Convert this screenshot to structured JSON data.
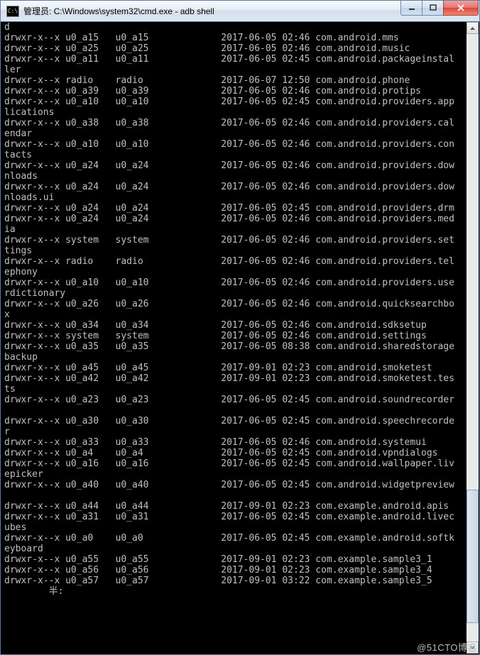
{
  "window": {
    "icon_text": "C:\\",
    "title": "管理员: C:\\Windows\\system32\\cmd.exe - adb  shell"
  },
  "prompt_lead": "d",
  "listing": [
    {
      "perm": "drwxr-x--x",
      "owner": "u0_a15",
      "group": "u0_a15",
      "date": "2017-06-05",
      "time": "02:46",
      "name": "com.android.mms",
      "wrap": ""
    },
    {
      "perm": "drwxr-x--x",
      "owner": "u0_a25",
      "group": "u0_a25",
      "date": "2017-06-05",
      "time": "02:46",
      "name": "com.android.music",
      "wrap": ""
    },
    {
      "perm": "drwxr-x--x",
      "owner": "u0_a11",
      "group": "u0_a11",
      "date": "2017-06-05",
      "time": "02:45",
      "name": "com.android.packageinstal",
      "wrap": "ler"
    },
    {
      "perm": "drwxr-x--x",
      "owner": "radio",
      "group": "radio",
      "date": "2017-06-07",
      "time": "12:50",
      "name": "com.android.phone",
      "wrap": ""
    },
    {
      "perm": "drwxr-x--x",
      "owner": "u0_a39",
      "group": "u0_a39",
      "date": "2017-06-05",
      "time": "02:46",
      "name": "com.android.protips",
      "wrap": ""
    },
    {
      "perm": "drwxr-x--x",
      "owner": "u0_a10",
      "group": "u0_a10",
      "date": "2017-06-05",
      "time": "02:45",
      "name": "com.android.providers.app",
      "wrap": "lications"
    },
    {
      "perm": "drwxr-x--x",
      "owner": "u0_a38",
      "group": "u0_a38",
      "date": "2017-06-05",
      "time": "02:46",
      "name": "com.android.providers.cal",
      "wrap": "endar"
    },
    {
      "perm": "drwxr-x--x",
      "owner": "u0_a10",
      "group": "u0_a10",
      "date": "2017-06-05",
      "time": "02:46",
      "name": "com.android.providers.con",
      "wrap": "tacts"
    },
    {
      "perm": "drwxr-x--x",
      "owner": "u0_a24",
      "group": "u0_a24",
      "date": "2017-06-05",
      "time": "02:46",
      "name": "com.android.providers.dow",
      "wrap": "nloads"
    },
    {
      "perm": "drwxr-x--x",
      "owner": "u0_a24",
      "group": "u0_a24",
      "date": "2017-06-05",
      "time": "02:46",
      "name": "com.android.providers.dow",
      "wrap": "nloads.ui"
    },
    {
      "perm": "drwxr-x--x",
      "owner": "u0_a24",
      "group": "u0_a24",
      "date": "2017-06-05",
      "time": "02:45",
      "name": "com.android.providers.drm",
      "wrap": ""
    },
    {
      "perm": "drwxr-x--x",
      "owner": "u0_a24",
      "group": "u0_a24",
      "date": "2017-06-05",
      "time": "02:46",
      "name": "com.android.providers.med",
      "wrap": "ia"
    },
    {
      "perm": "drwxr-x--x",
      "owner": "system",
      "group": "system",
      "date": "2017-06-05",
      "time": "02:46",
      "name": "com.android.providers.set",
      "wrap": "tings"
    },
    {
      "perm": "drwxr-x--x",
      "owner": "radio",
      "group": "radio",
      "date": "2017-06-05",
      "time": "02:46",
      "name": "com.android.providers.tel",
      "wrap": "ephony"
    },
    {
      "perm": "drwxr-x--x",
      "owner": "u0_a10",
      "group": "u0_a10",
      "date": "2017-06-05",
      "time": "02:46",
      "name": "com.android.providers.use",
      "wrap": "rdictionary"
    },
    {
      "perm": "drwxr-x--x",
      "owner": "u0_a26",
      "group": "u0_a26",
      "date": "2017-06-05",
      "time": "02:46",
      "name": "com.android.quicksearchbo",
      "wrap": "x"
    },
    {
      "perm": "drwxr-x--x",
      "owner": "u0_a34",
      "group": "u0_a34",
      "date": "2017-06-05",
      "time": "02:46",
      "name": "com.android.sdksetup",
      "wrap": ""
    },
    {
      "perm": "drwxr-x--x",
      "owner": "system",
      "group": "system",
      "date": "2017-06-05",
      "time": "02:46",
      "name": "com.android.settings",
      "wrap": ""
    },
    {
      "perm": "drwxr-x--x",
      "owner": "u0_a35",
      "group": "u0_a35",
      "date": "2017-06-05",
      "time": "08:38",
      "name": "com.android.sharedstorage",
      "wrap": "backup"
    },
    {
      "perm": "drwxr-x--x",
      "owner": "u0_a45",
      "group": "u0_a45",
      "date": "2017-09-01",
      "time": "02:23",
      "name": "com.android.smoketest",
      "wrap": ""
    },
    {
      "perm": "drwxr-x--x",
      "owner": "u0_a42",
      "group": "u0_a42",
      "date": "2017-09-01",
      "time": "02:23",
      "name": "com.android.smoketest.tes",
      "wrap": "ts"
    },
    {
      "perm": "drwxr-x--x",
      "owner": "u0_a23",
      "group": "u0_a23",
      "date": "2017-06-05",
      "time": "02:45",
      "name": "com.android.soundrecorder",
      "wrap": ""
    },
    {
      "perm": "drwxr-x--x",
      "owner": "u0_a30",
      "group": "u0_a30",
      "date": "2017-06-05",
      "time": "02:45",
      "name": "com.android.speechrecorde",
      "wrap": "r"
    },
    {
      "perm": "drwxr-x--x",
      "owner": "u0_a33",
      "group": "u0_a33",
      "date": "2017-06-05",
      "time": "02:46",
      "name": "com.android.systemui",
      "wrap": ""
    },
    {
      "perm": "drwxr-x--x",
      "owner": "u0_a4",
      "group": "u0_a4",
      "date": "2017-06-05",
      "time": "02:45",
      "name": "com.android.vpndialogs",
      "wrap": ""
    },
    {
      "perm": "drwxr-x--x",
      "owner": "u0_a16",
      "group": "u0_a16",
      "date": "2017-06-05",
      "time": "02:45",
      "name": "com.android.wallpaper.liv",
      "wrap": "epicker"
    },
    {
      "perm": "drwxr-x--x",
      "owner": "u0_a40",
      "group": "u0_a40",
      "date": "2017-06-05",
      "time": "02:45",
      "name": "com.android.widgetpreview",
      "wrap": ""
    },
    {
      "perm": "drwxr-x--x",
      "owner": "u0_a44",
      "group": "u0_a44",
      "date": "2017-09-01",
      "time": "02:23",
      "name": "com.example.android.apis",
      "wrap": ""
    },
    {
      "perm": "drwxr-x--x",
      "owner": "u0_a31",
      "group": "u0_a31",
      "date": "2017-06-05",
      "time": "02:45",
      "name": "com.example.android.livec",
      "wrap": "ubes"
    },
    {
      "perm": "drwxr-x--x",
      "owner": "u0_a0",
      "group": "u0_a0",
      "date": "2017-06-05",
      "time": "02:45",
      "name": "com.example.android.softk",
      "wrap": "eyboard"
    },
    {
      "perm": "drwxr-x--x",
      "owner": "u0_a55",
      "group": "u0_a55",
      "date": "2017-09-01",
      "time": "02:23",
      "name": "com.example.sample3_1",
      "wrap": ""
    },
    {
      "perm": "drwxr-x--x",
      "owner": "u0_a56",
      "group": "u0_a56",
      "date": "2017-09-01",
      "time": "02:23",
      "name": "com.example.sample3_4",
      "wrap": ""
    },
    {
      "perm": "drwxr-x--x",
      "owner": "u0_a57",
      "group": "u0_a57",
      "date": "2017-09-01",
      "time": "03:22",
      "name": "com.example.sample3_5",
      "wrap": ""
    }
  ],
  "prompt_tail": "        半:",
  "blank_after_widgetpreview": true,
  "watermark": "@51CTO博客"
}
